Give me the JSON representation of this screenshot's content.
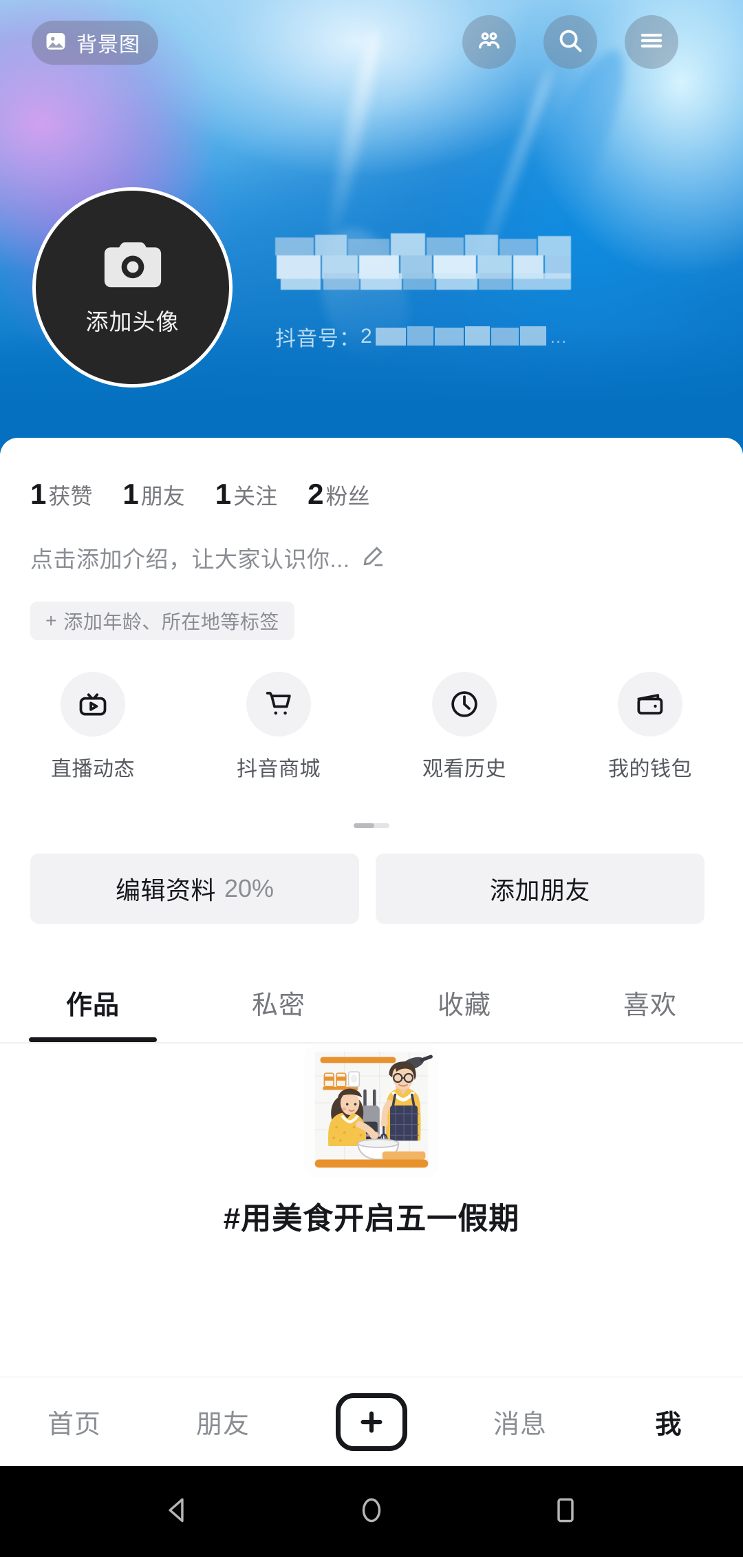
{
  "header": {
    "background_button": {
      "label": "背景图",
      "icon": "image-icon"
    },
    "actions": [
      {
        "name": "friends",
        "icon": "people-icon"
      },
      {
        "name": "search",
        "icon": "search-icon"
      },
      {
        "name": "menu",
        "icon": "hamburger-menu-icon"
      }
    ],
    "avatar": {
      "label": "添加头像",
      "icon": "camera-icon"
    },
    "nickname": "",
    "douyin_id_label": "抖音号：",
    "douyin_id_value": "2",
    "douyin_id_truncation": "..."
  },
  "stats": [
    {
      "num": "1",
      "caption": "获赞"
    },
    {
      "num": "1",
      "caption": "朋友"
    },
    {
      "num": "1",
      "caption": "关注"
    },
    {
      "num": "2",
      "caption": "粉丝"
    }
  ],
  "bio": {
    "placeholder": "点击添加介绍，让大家认识你...",
    "edit_icon": "pencil-icon",
    "tag_plus": "+",
    "tag_label": "添加年龄、所在地等标签"
  },
  "shortcuts": [
    {
      "label": "直播动态",
      "icon": "live-tv-icon"
    },
    {
      "label": "抖音商城",
      "icon": "shopping-cart-icon"
    },
    {
      "label": "观看历史",
      "icon": "clock-icon"
    },
    {
      "label": "我的钱包",
      "icon": "wallet-icon"
    }
  ],
  "actions": {
    "edit_profile": "编辑资料",
    "edit_progress": "20%",
    "add_friend": "添加朋友"
  },
  "tabs": [
    {
      "label": "作品",
      "active": true
    },
    {
      "label": "私密",
      "active": false
    },
    {
      "label": "收藏",
      "active": false
    },
    {
      "label": "喜欢",
      "active": false
    }
  ],
  "empty_state": {
    "illustration": "cooking-couple-illustration",
    "title": "#用美食开启五一假期"
  },
  "bottom_nav": [
    {
      "label": "首页",
      "active": false
    },
    {
      "label": "朋友",
      "active": false
    },
    {
      "label": "",
      "active": false,
      "icon": "plus-icon"
    },
    {
      "label": "消息",
      "active": false
    },
    {
      "label": "我",
      "active": true
    }
  ],
  "system_bar": [
    {
      "name": "back",
      "icon": "back-triangle-icon"
    },
    {
      "name": "home",
      "icon": "home-circle-icon"
    },
    {
      "name": "recents",
      "icon": "recents-square-icon"
    }
  ],
  "colors": {
    "banner_blue": "#0570c0",
    "accent_dark": "#16181c",
    "muted": "#8a8d93",
    "chip_bg": "#f2f2f4"
  }
}
